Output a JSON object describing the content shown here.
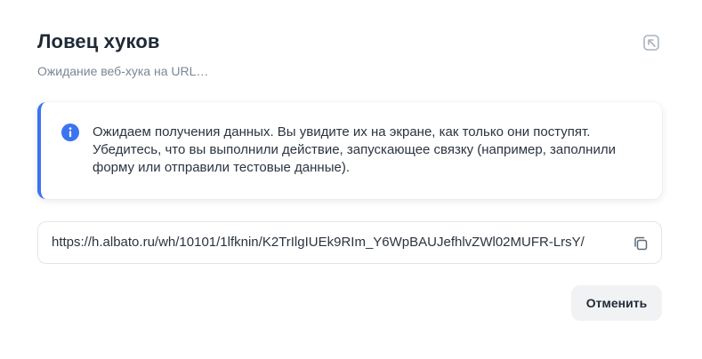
{
  "dialog": {
    "title": "Ловец хуков",
    "subtitle": "Ожидание веб-хука на URL…",
    "collapse_icon": "collapse-arrow-icon"
  },
  "notice": {
    "icon": "info-icon",
    "accent_color": "#3b74f2",
    "text": "Ожидаем получения данных. Вы увидите их на экране, как только они поступят. Убедитесь, что вы выполнили действие, запускающее связку (например, заполнили форму или отправили тестовые данные)."
  },
  "webhook": {
    "url": "https://h.albato.ru/wh/10101/1lfknin/K2TrIlgIUEk9RIm_Y6WpBAUJefhlvZWl02MUFR-LrsY/",
    "copy_icon": "copy-icon"
  },
  "actions": {
    "cancel_label": "Отменить"
  }
}
